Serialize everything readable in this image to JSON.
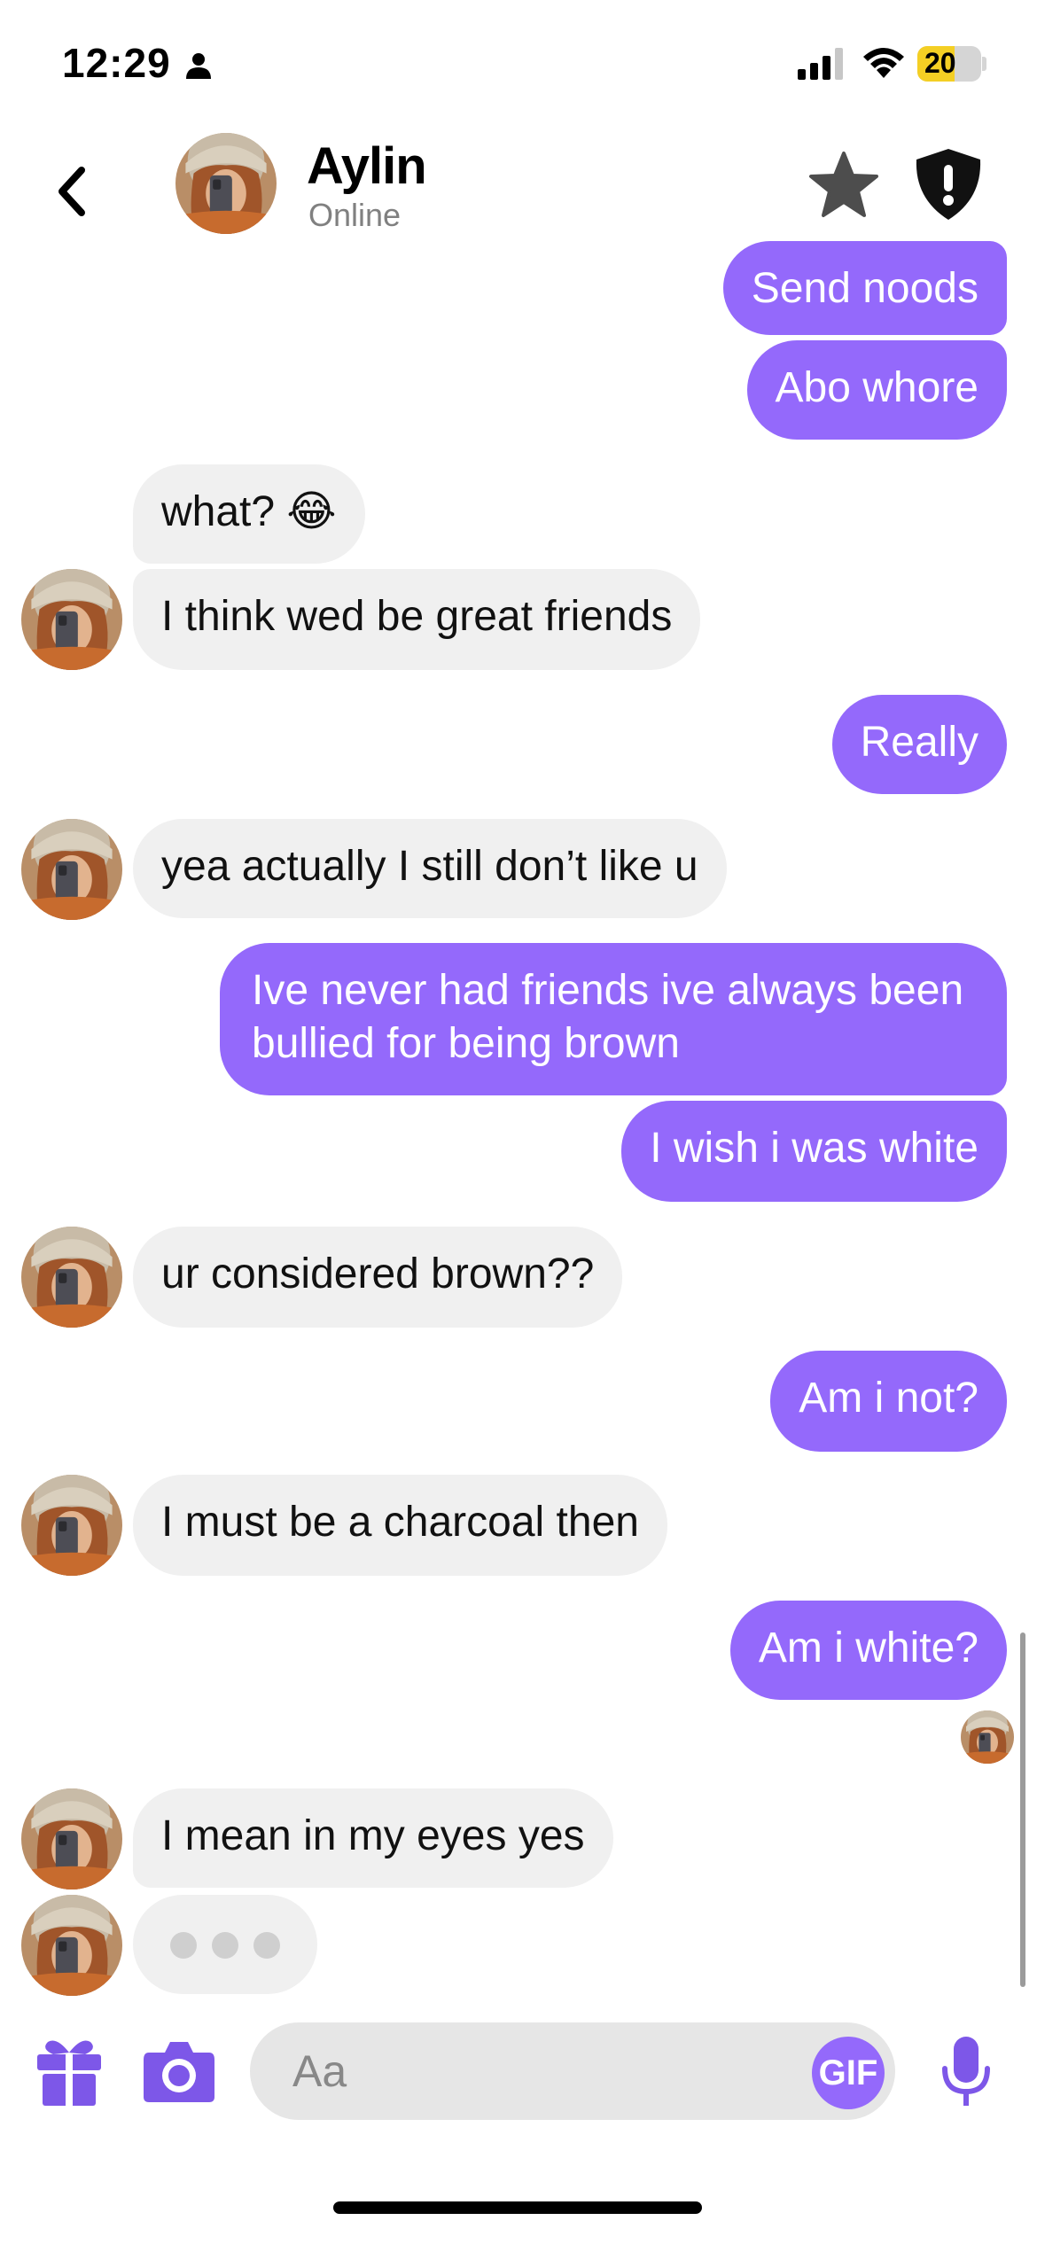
{
  "status_bar": {
    "time": "12:29",
    "battery": "20",
    "battery_level_percent": 20
  },
  "header": {
    "name": "Aylin",
    "status": "Online"
  },
  "messages": [
    {
      "side": "out",
      "text": "Send noods"
    },
    {
      "side": "out",
      "text": "Abo whore"
    },
    {
      "side": "in",
      "text": "what? 😂"
    },
    {
      "side": "in",
      "text": "I think wed be great friends"
    },
    {
      "side": "out",
      "text": "Really"
    },
    {
      "side": "in",
      "text": "yea actually I still don’t like u"
    },
    {
      "side": "out",
      "text": "Ive never had friends ive always been"
    },
    {
      "side": "out",
      "text": "bullied for being brown"
    },
    {
      "side": "out",
      "text": "I wish i was white"
    },
    {
      "side": "in",
      "text": "ur considered brown??"
    },
    {
      "side": "out",
      "text": "Am i not?"
    },
    {
      "side": "in",
      "text": "I must be a charcoal then"
    },
    {
      "side": "out",
      "text": "Am i white?"
    },
    {
      "side": "in",
      "text": "I mean in my eyes yes"
    }
  ],
  "composer": {
    "placeholder": "Aa",
    "gif_label": "GIF"
  },
  "colors": {
    "accent": "#9469fb",
    "incoming_bubble": "#f0f0f0",
    "battery": "#f4cf24"
  },
  "icons": [
    "person-icon",
    "signal-icon",
    "wifi-icon",
    "battery-icon",
    "back-chevron-icon",
    "star-icon",
    "shield-alert-icon",
    "gift-icon",
    "camera-icon",
    "microphone-icon"
  ]
}
